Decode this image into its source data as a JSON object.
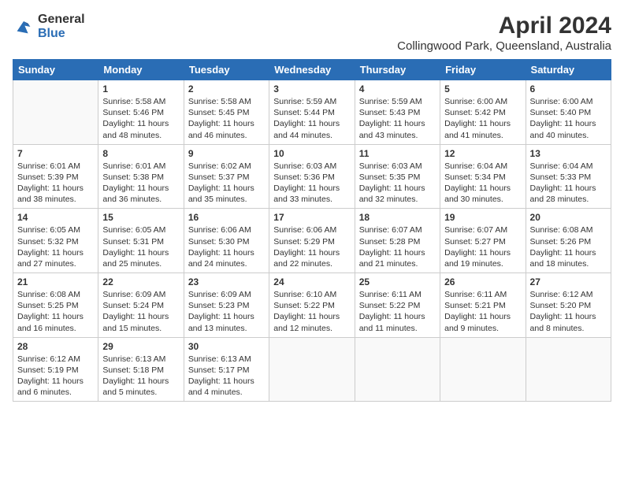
{
  "logo": {
    "line1": "General",
    "line2": "Blue"
  },
  "title": "April 2024",
  "subtitle": "Collingwood Park, Queensland, Australia",
  "headers": [
    "Sunday",
    "Monday",
    "Tuesday",
    "Wednesday",
    "Thursday",
    "Friday",
    "Saturday"
  ],
  "weeks": [
    [
      {
        "day": "",
        "info": ""
      },
      {
        "day": "1",
        "info": "Sunrise: 5:58 AM\nSunset: 5:46 PM\nDaylight: 11 hours\nand 48 minutes."
      },
      {
        "day": "2",
        "info": "Sunrise: 5:58 AM\nSunset: 5:45 PM\nDaylight: 11 hours\nand 46 minutes."
      },
      {
        "day": "3",
        "info": "Sunrise: 5:59 AM\nSunset: 5:44 PM\nDaylight: 11 hours\nand 44 minutes."
      },
      {
        "day": "4",
        "info": "Sunrise: 5:59 AM\nSunset: 5:43 PM\nDaylight: 11 hours\nand 43 minutes."
      },
      {
        "day": "5",
        "info": "Sunrise: 6:00 AM\nSunset: 5:42 PM\nDaylight: 11 hours\nand 41 minutes."
      },
      {
        "day": "6",
        "info": "Sunrise: 6:00 AM\nSunset: 5:40 PM\nDaylight: 11 hours\nand 40 minutes."
      }
    ],
    [
      {
        "day": "7",
        "info": "Sunrise: 6:01 AM\nSunset: 5:39 PM\nDaylight: 11 hours\nand 38 minutes."
      },
      {
        "day": "8",
        "info": "Sunrise: 6:01 AM\nSunset: 5:38 PM\nDaylight: 11 hours\nand 36 minutes."
      },
      {
        "day": "9",
        "info": "Sunrise: 6:02 AM\nSunset: 5:37 PM\nDaylight: 11 hours\nand 35 minutes."
      },
      {
        "day": "10",
        "info": "Sunrise: 6:03 AM\nSunset: 5:36 PM\nDaylight: 11 hours\nand 33 minutes."
      },
      {
        "day": "11",
        "info": "Sunrise: 6:03 AM\nSunset: 5:35 PM\nDaylight: 11 hours\nand 32 minutes."
      },
      {
        "day": "12",
        "info": "Sunrise: 6:04 AM\nSunset: 5:34 PM\nDaylight: 11 hours\nand 30 minutes."
      },
      {
        "day": "13",
        "info": "Sunrise: 6:04 AM\nSunset: 5:33 PM\nDaylight: 11 hours\nand 28 minutes."
      }
    ],
    [
      {
        "day": "14",
        "info": "Sunrise: 6:05 AM\nSunset: 5:32 PM\nDaylight: 11 hours\nand 27 minutes."
      },
      {
        "day": "15",
        "info": "Sunrise: 6:05 AM\nSunset: 5:31 PM\nDaylight: 11 hours\nand 25 minutes."
      },
      {
        "day": "16",
        "info": "Sunrise: 6:06 AM\nSunset: 5:30 PM\nDaylight: 11 hours\nand 24 minutes."
      },
      {
        "day": "17",
        "info": "Sunrise: 6:06 AM\nSunset: 5:29 PM\nDaylight: 11 hours\nand 22 minutes."
      },
      {
        "day": "18",
        "info": "Sunrise: 6:07 AM\nSunset: 5:28 PM\nDaylight: 11 hours\nand 21 minutes."
      },
      {
        "day": "19",
        "info": "Sunrise: 6:07 AM\nSunset: 5:27 PM\nDaylight: 11 hours\nand 19 minutes."
      },
      {
        "day": "20",
        "info": "Sunrise: 6:08 AM\nSunset: 5:26 PM\nDaylight: 11 hours\nand 18 minutes."
      }
    ],
    [
      {
        "day": "21",
        "info": "Sunrise: 6:08 AM\nSunset: 5:25 PM\nDaylight: 11 hours\nand 16 minutes."
      },
      {
        "day": "22",
        "info": "Sunrise: 6:09 AM\nSunset: 5:24 PM\nDaylight: 11 hours\nand 15 minutes."
      },
      {
        "day": "23",
        "info": "Sunrise: 6:09 AM\nSunset: 5:23 PM\nDaylight: 11 hours\nand 13 minutes."
      },
      {
        "day": "24",
        "info": "Sunrise: 6:10 AM\nSunset: 5:22 PM\nDaylight: 11 hours\nand 12 minutes."
      },
      {
        "day": "25",
        "info": "Sunrise: 6:11 AM\nSunset: 5:22 PM\nDaylight: 11 hours\nand 11 minutes."
      },
      {
        "day": "26",
        "info": "Sunrise: 6:11 AM\nSunset: 5:21 PM\nDaylight: 11 hours\nand 9 minutes."
      },
      {
        "day": "27",
        "info": "Sunrise: 6:12 AM\nSunset: 5:20 PM\nDaylight: 11 hours\nand 8 minutes."
      }
    ],
    [
      {
        "day": "28",
        "info": "Sunrise: 6:12 AM\nSunset: 5:19 PM\nDaylight: 11 hours\nand 6 minutes."
      },
      {
        "day": "29",
        "info": "Sunrise: 6:13 AM\nSunset: 5:18 PM\nDaylight: 11 hours\nand 5 minutes."
      },
      {
        "day": "30",
        "info": "Sunrise: 6:13 AM\nSunset: 5:17 PM\nDaylight: 11 hours\nand 4 minutes."
      },
      {
        "day": "",
        "info": ""
      },
      {
        "day": "",
        "info": ""
      },
      {
        "day": "",
        "info": ""
      },
      {
        "day": "",
        "info": ""
      }
    ]
  ]
}
